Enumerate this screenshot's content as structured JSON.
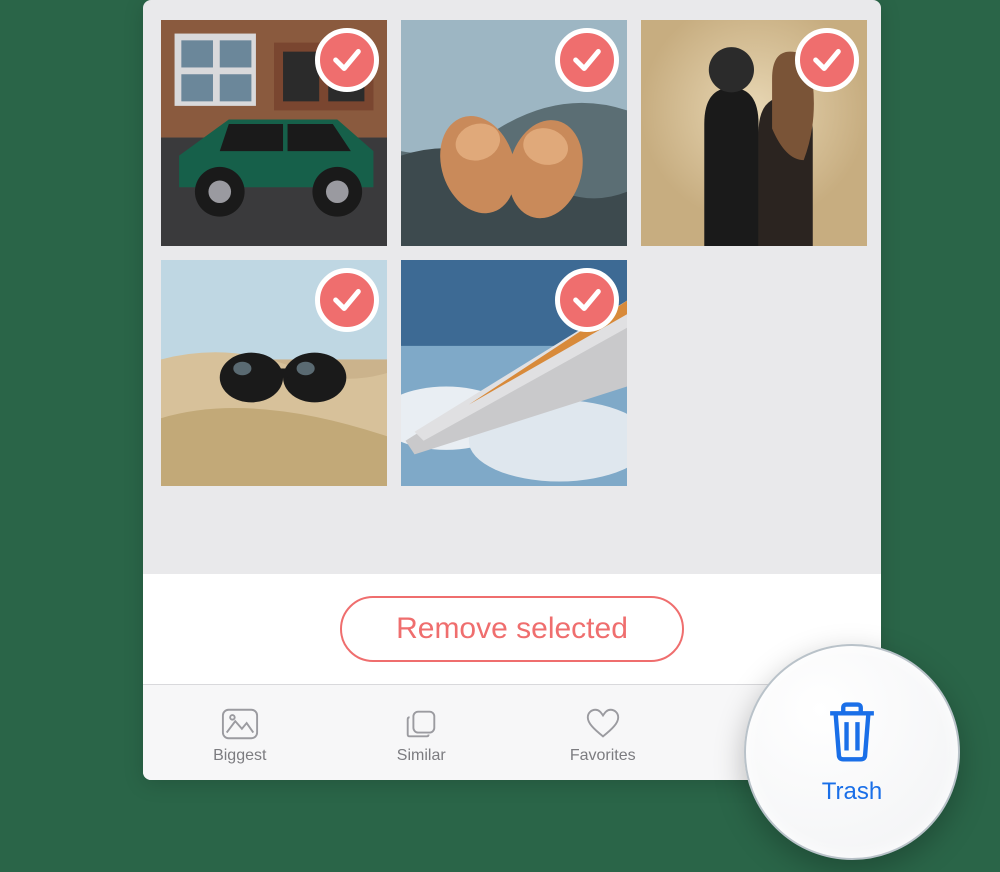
{
  "photos": [
    {
      "name": "car-photo",
      "selected": true
    },
    {
      "name": "shoes-photo",
      "selected": true
    },
    {
      "name": "couple-photo",
      "selected": true
    },
    {
      "name": "sunglasses-photo",
      "selected": true
    },
    {
      "name": "plane-wing-photo",
      "selected": true
    }
  ],
  "actions": {
    "remove_selected_label": "Remove selected"
  },
  "tabs": [
    {
      "id": "biggest",
      "label": "Biggest",
      "icon": "mountains-icon",
      "active": false
    },
    {
      "id": "similar",
      "label": "Similar",
      "icon": "stack-icon",
      "active": false
    },
    {
      "id": "favorites",
      "label": "Favorites",
      "icon": "heart-icon",
      "active": false
    },
    {
      "id": "trash",
      "label": "Trash",
      "icon": "trash-icon",
      "active": true
    }
  ],
  "magnified_tab": {
    "label": "Trash",
    "icon": "trash-icon"
  },
  "colors": {
    "accent_red": "#ef6e6e",
    "accent_blue": "#1a6fe8",
    "panel_bg": "#e9e9eb"
  }
}
